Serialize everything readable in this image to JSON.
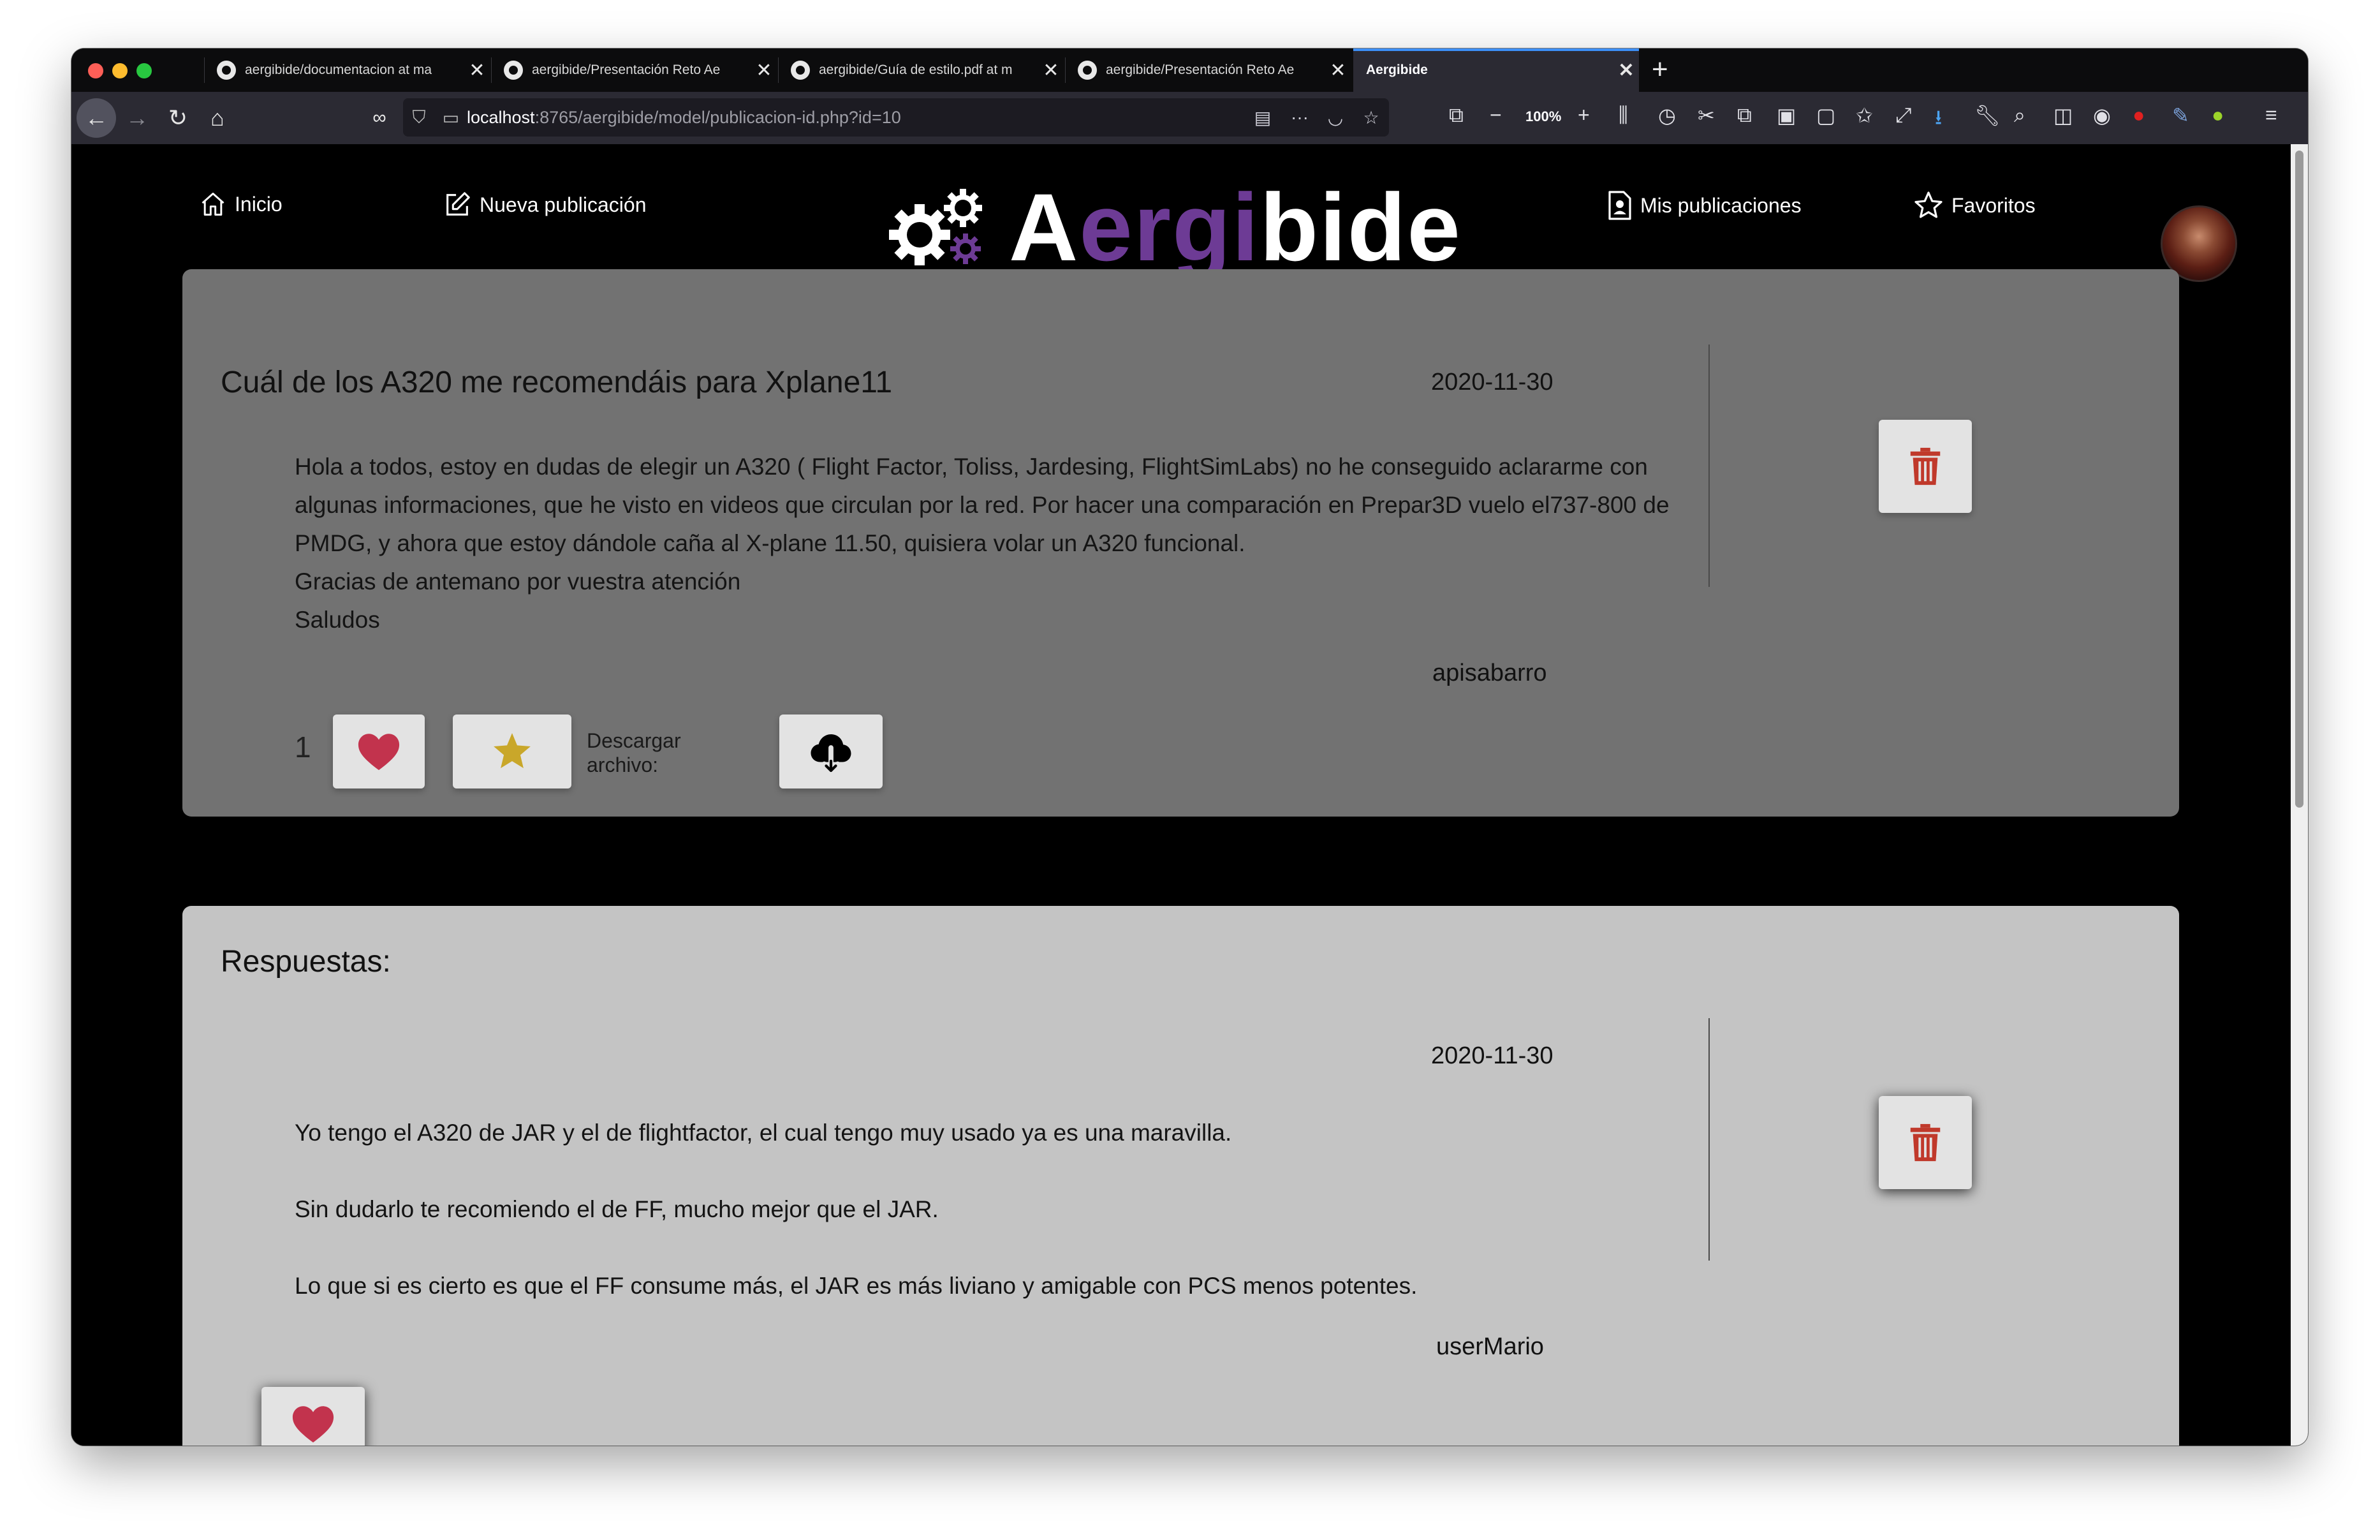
{
  "browser": {
    "tabs": [
      {
        "title": "aergibide/documentacion at ma",
        "active": false
      },
      {
        "title": "aergibide/Presentación Reto Ae",
        "active": false
      },
      {
        "title": "aergibide/Guía de estilo.pdf at m",
        "active": false
      },
      {
        "title": "aergibide/Presentación Reto Ae",
        "active": false
      },
      {
        "title": "Aergibide",
        "active": true
      }
    ],
    "url_host": "localhost",
    "url_path": ":8765/aergibide/model/publicacion-id.php?id=10",
    "zoom": "100%"
  },
  "site_nav": {
    "home": "Inicio",
    "new_post": "Nueva publicación",
    "logo_prefix": "A",
    "logo_highlight": "ergi",
    "logo_suffix": "bide",
    "my_posts": "Mis publicaciones",
    "favorites": "Favoritos"
  },
  "post": {
    "title": "Cuál de los A320 me recomendáis para Xplane11",
    "date": "2020-11-30",
    "body_lines": [
      "Hola a todos, estoy en dudas de elegir un A320 ( Flight Factor, Toliss, Jardesing, FlightSimLabs) no he conseguido aclararme con algunas informaciones, que he visto en videos que circulan por la red. Por hacer una comparación en Prepar3D vuelo el737-800 de PMDG, y ahora que estoy dándole caña al X-plane 11.50, quisiera volar un A320 funcional.",
      "Gracias de antemano por vuestra atención",
      "Saludos"
    ],
    "author": "apisabarro",
    "likes": "1",
    "download_label": "Descargar archivo:"
  },
  "replies": {
    "title": "Respuestas:",
    "items": [
      {
        "date": "2020-11-30",
        "paragraphs": [
          "Yo tengo el A320 de JAR y el de flightfactor, el cual tengo muy usado ya es una maravilla.",
          "Sin dudarlo te recomiendo el de FF, mucho mejor que el JAR.",
          "Lo que si es cierto es que el FF consume más, el JAR es más liviano y amigable con PCS menos potentes."
        ],
        "author": "userMario"
      }
    ]
  },
  "colors": {
    "accent": "#6d3b95",
    "heart": "#c2334d",
    "star": "#c9a72a",
    "trash": "#c0392b"
  }
}
